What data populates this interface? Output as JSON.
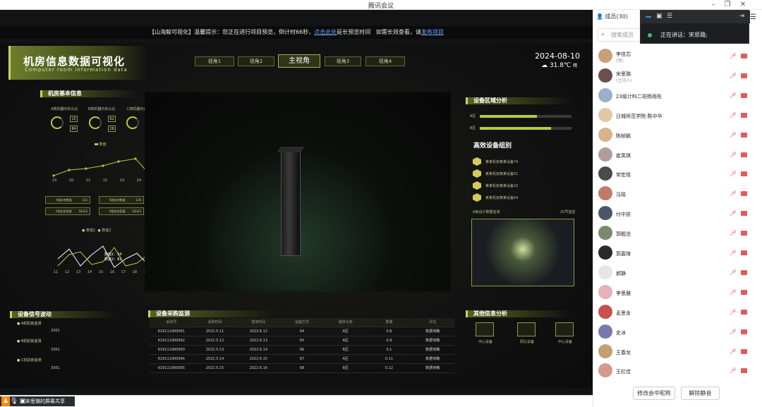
{
  "window": {
    "title": "腾讯会议"
  },
  "notice": {
    "prefix": "【山海鲸可视化】温馨提示：您正在进行项目预览，倒计时66秒，",
    "link": "点击此处",
    "mid": "延长预览时间",
    "suffix": "如需长效查看，请",
    "link2": "发布项目"
  },
  "dashboard": {
    "title": "机房信息数据可视化",
    "subtitle": "Computer room information data",
    "tabs": [
      "视角1",
      "视角2",
      "主视角",
      "视角3",
      "视角4"
    ],
    "date": "2024-08-10",
    "temp": "31.8℃",
    "weather_note": "晴",
    "sections": {
      "basic": "机房基本信息",
      "signal": "设备信号波动",
      "purchase": "设备采购监测",
      "region": "设备区域分析",
      "group": "高效设备组别",
      "other": "其他信息分析"
    },
    "kpis": [
      {
        "label": "A类机器内存占比",
        "v1": "15",
        "v2": "84"
      },
      {
        "label": "B类机器内存占比",
        "v1": "62",
        "v2": "28"
      },
      {
        "label": "C类机器内存占比",
        "v1": "75",
        "v2": "25"
      }
    ],
    "legend_single": "数值",
    "line_x": [
      "19",
      "20",
      "21",
      "22",
      "23",
      "24",
      "25"
    ],
    "stats": [
      {
        "name": "A类机房数量",
        "value": "132"
      },
      {
        "name": "B类机房数量",
        "value": "126"
      },
      {
        "name": "A类机房容量",
        "value": "18333"
      },
      {
        "name": "B类机房容量",
        "value": "18333"
      }
    ],
    "legend2": [
      "数值1",
      "数值2"
    ],
    "y_ticks": [
      "100",
      "90",
      "80",
      "70",
      "60",
      "50",
      "40",
      "30",
      "20",
      "10"
    ],
    "x_ticks2": [
      "11",
      "12",
      "13",
      "14",
      "15",
      "16",
      "17",
      "18",
      "19",
      "20"
    ],
    "tooltip": {
      "l1": "数值1：",
      "v1": "54",
      "l2": "数值2：",
      "v2": "81"
    },
    "region_bars": [
      {
        "name": "A区",
        "pct": 0.62
      },
      {
        "name": "B区",
        "pct": 0.78
      }
    ],
    "groups": [
      "某某机房某某设备74",
      "某某机房某某设备51",
      "某某机房某某设备22",
      "某某机房某某设备64"
    ],
    "chip_label": "A级设计数据监测",
    "chip_label2": "25号监控",
    "signals": [
      {
        "name": "A机机房监测",
        "v": "3301"
      },
      {
        "name": "B机机房监测",
        "v": "3301"
      },
      {
        "name": "C机机房监测",
        "v": "3301"
      }
    ],
    "table": {
      "head": [
        "采购号",
        "采购时间",
        "签收时间",
        "运输方式",
        "储存仓库",
        "数量",
        "评估"
      ],
      "rows": [
        [
          "619111060061",
          "2022.5.11",
          "2022.6.12",
          "64",
          "A区",
          "0.8",
          "数据待确"
        ],
        [
          "619111060062",
          "2022.5.12",
          "2022.6.13",
          "65",
          "A区",
          "0.9",
          "数据待确"
        ],
        [
          "619111060063",
          "2022.5.13",
          "2022.6.14",
          "66",
          "B区",
          "0.1",
          "数据待确"
        ],
        [
          "619111060064",
          "2022.5.14",
          "2022.6.15",
          "67",
          "A区",
          "0.11",
          "数据待确"
        ],
        [
          "619111060065",
          "2022.5.15",
          "2022.6.16",
          "68",
          "B区",
          "0.12",
          "数据待确"
        ]
      ]
    },
    "cards": [
      "中心设备",
      "原比设备",
      "中心设备"
    ]
  },
  "footer": {
    "share": "宋思璐的屏幕共享"
  },
  "sidebar": {
    "members_title": "成员(30)",
    "search_placeholder": "搜索成员",
    "speaking": "正在讲话：宋思璐;",
    "members": [
      {
        "name": "李佳芯",
        "sub": "(我)"
      },
      {
        "name": "宋思璐",
        "sub": "(主持人)"
      },
      {
        "name": "23级计科二班杨雨彤",
        "sub": ""
      },
      {
        "name": "日城师范学院-陈中华",
        "sub": ""
      },
      {
        "name": "陈帧鹏",
        "sub": ""
      },
      {
        "name": "崔英琪",
        "sub": ""
      },
      {
        "name": "常宏祖",
        "sub": ""
      },
      {
        "name": "冯瑶",
        "sub": ""
      },
      {
        "name": "付中凯",
        "sub": ""
      },
      {
        "name": "郭鲲沧",
        "sub": ""
      },
      {
        "name": "郭嘉琦",
        "sub": ""
      },
      {
        "name": "郝静",
        "sub": ""
      },
      {
        "name": "李思雅",
        "sub": ""
      },
      {
        "name": "孟思含",
        "sub": ""
      },
      {
        "name": "史冰",
        "sub": ""
      },
      {
        "name": "王春龙",
        "sub": ""
      },
      {
        "name": "王红佳",
        "sub": ""
      }
    ],
    "rename_btn": "修改会中昵称",
    "unmute_btn": "解除静音"
  }
}
